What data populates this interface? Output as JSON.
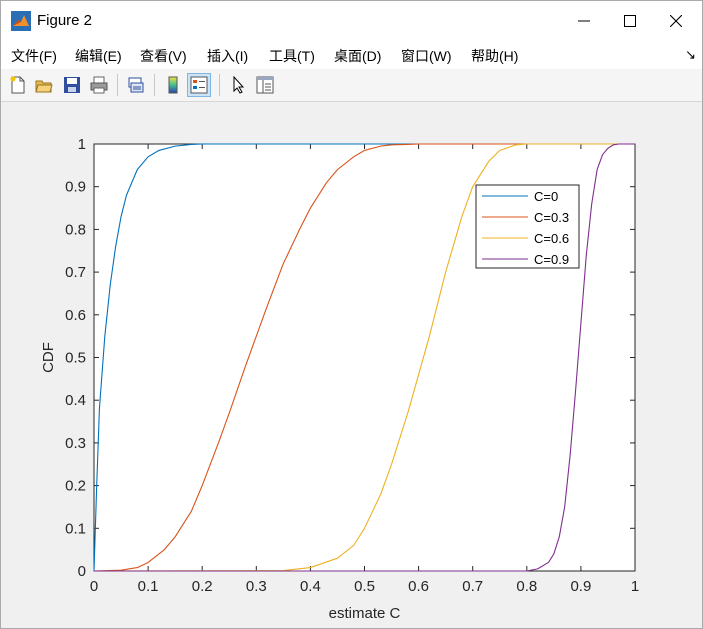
{
  "window": {
    "title": "Figure 2",
    "menu": [
      "文件(F)",
      "编辑(E)",
      "查看(V)",
      "插入(I)",
      "工具(T)",
      "桌面(D)",
      "窗口(W)",
      "帮助(H)"
    ],
    "menu_arrow": "↘",
    "toolbar_icons": [
      "new-figure-icon",
      "open-file-icon",
      "save-icon",
      "print-icon",
      "link-plot-icon",
      "colorbar-icon",
      "legend-icon",
      "pointer-icon",
      "property-editor-icon"
    ]
  },
  "chart_data": {
    "type": "line",
    "xlabel": "estimate C",
    "ylabel": "CDF",
    "xlim": [
      0,
      1
    ],
    "ylim": [
      0,
      1
    ],
    "xticks": [
      "0",
      "0.1",
      "0.2",
      "0.3",
      "0.4",
      "0.5",
      "0.6",
      "0.7",
      "0.8",
      "0.9",
      "1"
    ],
    "yticks": [
      "0",
      "0.1",
      "0.2",
      "0.3",
      "0.4",
      "0.5",
      "0.6",
      "0.7",
      "0.8",
      "0.9",
      "1"
    ],
    "grid": false,
    "legend": "top-right",
    "series": [
      {
        "name": "C=0",
        "color": "#0072bd",
        "x": [
          0,
          0.005,
          0.01,
          0.02,
          0.03,
          0.04,
          0.05,
          0.06,
          0.08,
          0.1,
          0.12,
          0.15,
          0.18,
          0.2,
          0.5,
          1.0
        ],
        "y": [
          0,
          0.2,
          0.38,
          0.55,
          0.67,
          0.76,
          0.83,
          0.88,
          0.94,
          0.97,
          0.985,
          0.995,
          0.999,
          1,
          1,
          1
        ]
      },
      {
        "name": "C=0.3",
        "color": "#d95319",
        "x": [
          0,
          0.05,
          0.08,
          0.1,
          0.13,
          0.15,
          0.18,
          0.2,
          0.23,
          0.25,
          0.28,
          0.3,
          0.32,
          0.35,
          0.38,
          0.4,
          0.43,
          0.45,
          0.48,
          0.5,
          0.53,
          0.55,
          0.58,
          0.6,
          1.0
        ],
        "y": [
          0,
          0.002,
          0.008,
          0.02,
          0.05,
          0.08,
          0.14,
          0.2,
          0.3,
          0.37,
          0.48,
          0.55,
          0.62,
          0.72,
          0.8,
          0.85,
          0.91,
          0.94,
          0.97,
          0.985,
          0.995,
          0.998,
          0.999,
          1,
          1
        ]
      },
      {
        "name": "C=0.6",
        "color": "#edb120",
        "x": [
          0,
          0.35,
          0.4,
          0.45,
          0.48,
          0.5,
          0.53,
          0.55,
          0.58,
          0.6,
          0.62,
          0.65,
          0.68,
          0.7,
          0.73,
          0.75,
          0.78,
          0.8,
          1.0
        ],
        "y": [
          0,
          0.001,
          0.008,
          0.03,
          0.06,
          0.1,
          0.18,
          0.25,
          0.37,
          0.46,
          0.55,
          0.7,
          0.83,
          0.9,
          0.96,
          0.985,
          0.998,
          1,
          1
        ]
      },
      {
        "name": "C=0.9",
        "color": "#7e2f8e",
        "x": [
          0,
          0.8,
          0.82,
          0.84,
          0.85,
          0.86,
          0.87,
          0.88,
          0.89,
          0.9,
          0.91,
          0.92,
          0.93,
          0.94,
          0.95,
          0.96,
          0.97,
          1.0
        ],
        "y": [
          0,
          0,
          0.005,
          0.02,
          0.04,
          0.08,
          0.15,
          0.27,
          0.42,
          0.58,
          0.74,
          0.86,
          0.94,
          0.975,
          0.99,
          0.998,
          1,
          1
        ]
      }
    ]
  }
}
